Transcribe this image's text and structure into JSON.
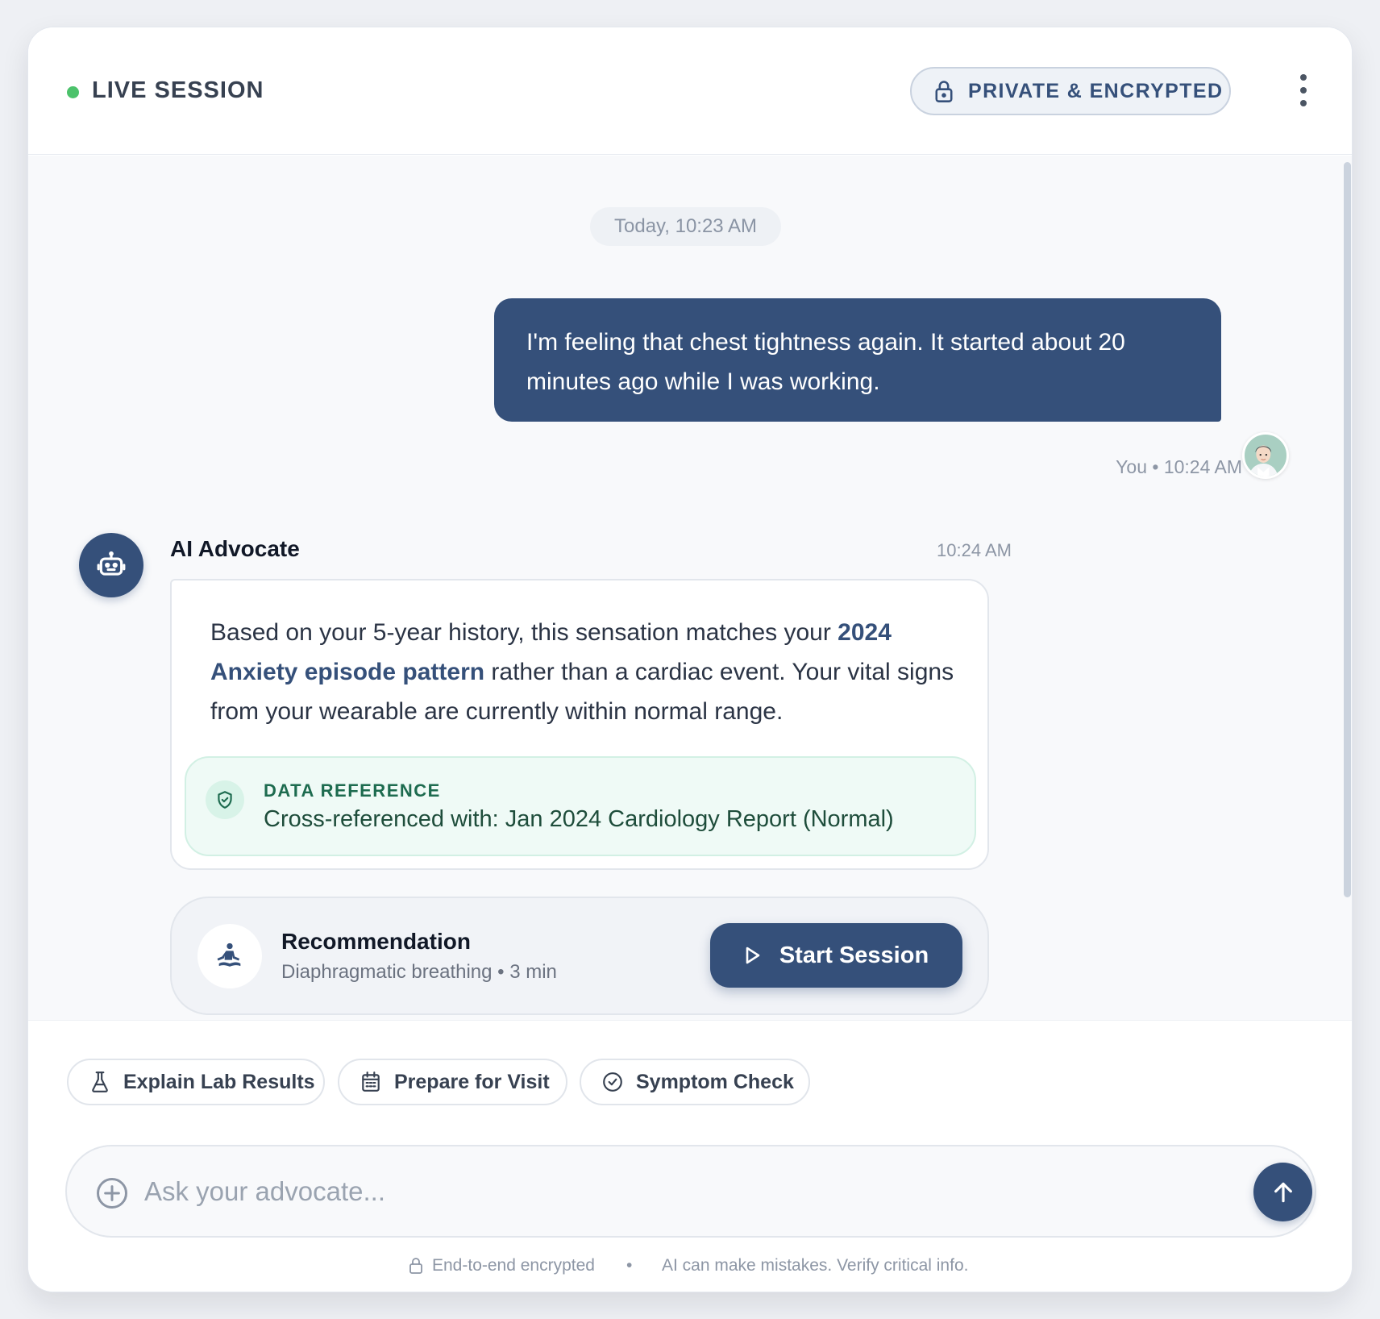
{
  "header": {
    "status_label": "LIVE SESSION",
    "privacy_badge": "PRIVATE & ENCRYPTED",
    "status_color": "#4cc26b",
    "accent_color": "#35507a"
  },
  "chat": {
    "date_divider": "Today, 10:23 AM",
    "user_message": {
      "text": "I'm feeling that chest tightness again. It started about 20 minutes ago while I was working.",
      "meta": "You • 10:24 AM"
    },
    "bot_message": {
      "sender": "AI Advocate",
      "time": "10:24 AM",
      "text_before": "Based on your 5-year history, this sensation matches your ",
      "highlight": "2024 Anxiety episode pattern",
      "text_after": " rather than a cardiac event. Your vital signs from your wearable are currently within normal range.",
      "data_reference": {
        "title": "DATA REFERENCE",
        "body": "Cross-referenced with: Jan 2024 Cardiology Report (Normal)"
      }
    },
    "recommendation": {
      "title": "Recommendation",
      "subtitle": "Diaphragmatic breathing • 3 min",
      "button_label": "Start Session"
    }
  },
  "quick_actions": [
    {
      "label": "Explain Lab Results",
      "icon": "flask-icon"
    },
    {
      "label": "Prepare for Visit",
      "icon": "calendar-icon"
    },
    {
      "label": "Symptom Check",
      "icon": "check-circle-icon"
    }
  ],
  "composer": {
    "placeholder": "Ask your advocate...",
    "value": ""
  },
  "footer": {
    "encryption_note": "End-to-end encrypted",
    "separator": "•",
    "disclaimer": "AI can make mistakes. Verify critical info."
  }
}
